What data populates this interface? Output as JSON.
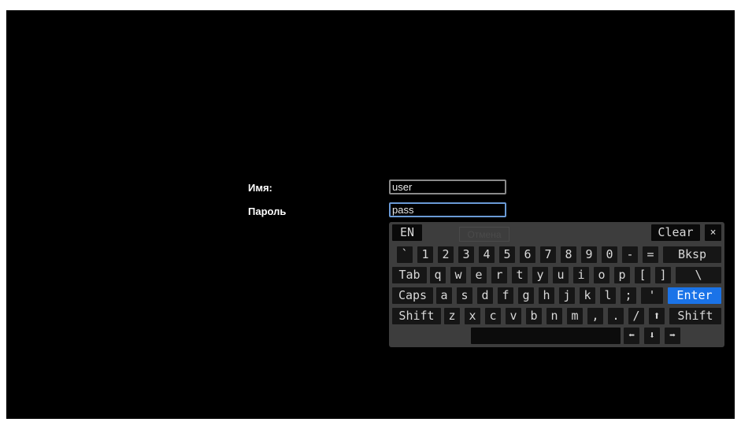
{
  "form": {
    "name_label": "Имя:",
    "name_value": "user",
    "password_label": "Пароль",
    "password_value": "pass"
  },
  "keyboard": {
    "lang": "EN",
    "cancel": "Отмена",
    "clear": "Clear",
    "close": "×",
    "row1": [
      "`",
      "1",
      "2",
      "3",
      "4",
      "5",
      "6",
      "7",
      "8",
      "9",
      "0",
      "-",
      "=",
      "Bksp"
    ],
    "row2": [
      "Tab",
      "q",
      "w",
      "e",
      "r",
      "t",
      "y",
      "u",
      "i",
      "o",
      "p",
      "[",
      "]",
      "\\"
    ],
    "row3": [
      "Caps",
      "a",
      "s",
      "d",
      "f",
      "g",
      "h",
      "j",
      "k",
      "l",
      ";",
      "'",
      "Enter"
    ],
    "row4": [
      "Shift",
      "z",
      "x",
      "c",
      "v",
      "b",
      "n",
      "m",
      ",",
      ".",
      "/",
      "⬆",
      "Shift"
    ],
    "row5": [
      "⬅",
      "⬇",
      "➡"
    ],
    "accent_color": "#1a73e8"
  }
}
